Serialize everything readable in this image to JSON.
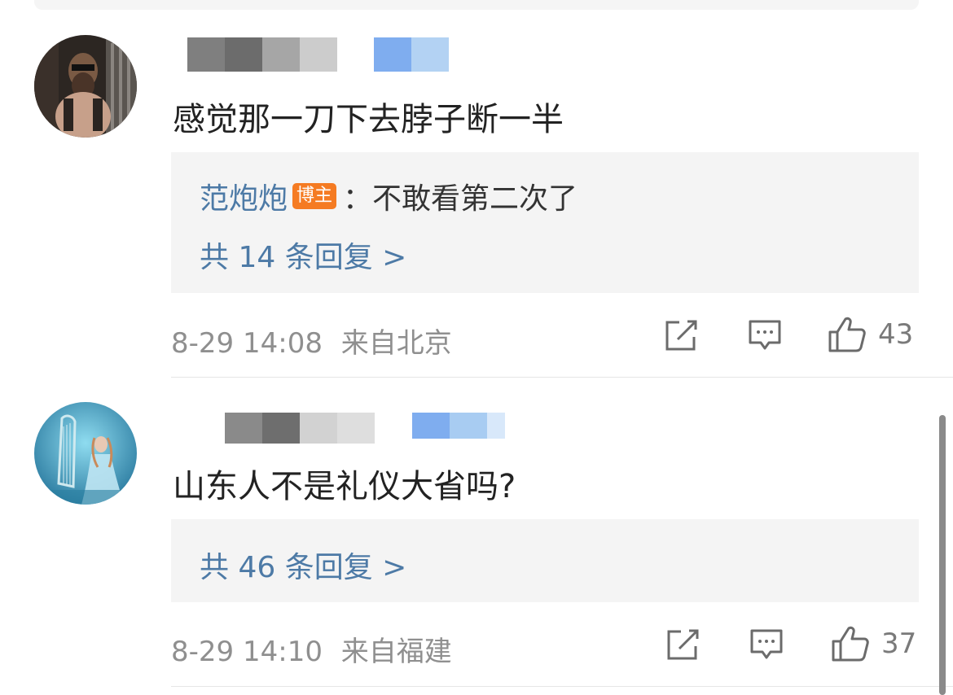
{
  "comments": [
    {
      "text": "感觉那一刀下去脖子断一半",
      "reply_preview": {
        "author": "范炮炮",
        "badge": "博主",
        "text": "：不敢看第二次了"
      },
      "reply_count": "共 14 条回复 >",
      "timestamp": "8-29 14:08",
      "location": "来自北京",
      "likes": "43"
    },
    {
      "text": "山东人不是礼仪大省吗?",
      "reply_count": "共 46 条回复 >",
      "timestamp": "8-29 14:10",
      "location": "来自福建",
      "likes": "37"
    }
  ],
  "icons": {
    "share": "share-icon",
    "comment": "comment-icon",
    "like": "thumbs-up-icon"
  },
  "colors": {
    "link_blue": "#4d7aa6",
    "badge_orange": "#f57b22",
    "reply_bg": "#f4f4f4",
    "meta_gray": "#8f8f8f"
  }
}
